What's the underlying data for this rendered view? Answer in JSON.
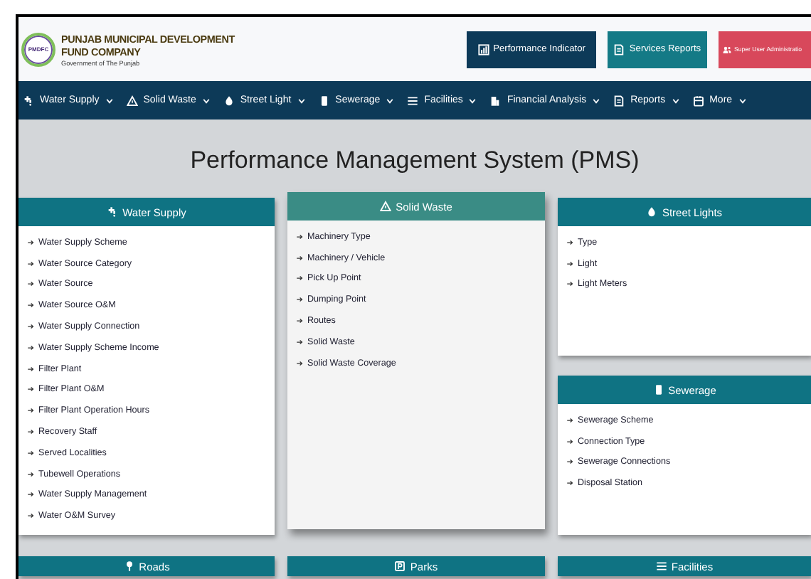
{
  "header": {
    "logo_text": "PMDFC",
    "org_line1": "PUNJAB MUNICIPAL DEVELOPMENT",
    "org_line2": "FUND COMPANY",
    "subtitle": "Government of The Punjab"
  },
  "buttons": [
    {
      "label": "Performance Indicator",
      "kind": "navy"
    },
    {
      "label": "Services Reports",
      "kind": "teal"
    },
    {
      "label": "Super User Administratio",
      "kind": "danger"
    }
  ],
  "nav": [
    {
      "label": "Water Supply"
    },
    {
      "label": "Solid Waste"
    },
    {
      "label": "Street Light"
    },
    {
      "label": "Sewerage"
    },
    {
      "label": "Facilities"
    },
    {
      "label": "Financial Analysis"
    },
    {
      "label": "Reports"
    },
    {
      "label": "More"
    }
  ],
  "page_title": "Performance Management System (PMS)",
  "cards": [
    {
      "title": "Water Supply",
      "kind": "tall",
      "highlighted": false,
      "items": [
        "Water Supply Scheme",
        "Water Source Category",
        "Water Source",
        "Water Source O&M",
        "Water Supply Connection",
        "Water Supply Scheme Income",
        "Filter Plant",
        "Filter Plant O&M",
        "Filter Plant Operation Hours",
        "Recovery Staff",
        "Served Localities",
        "Tubewell Operations",
        "Water Supply Management",
        "Water O&M Survey"
      ]
    },
    {
      "title": "Roads",
      "kind": "short",
      "highlighted": false
    },
    {
      "title": "Solid Waste",
      "kind": "tall",
      "highlighted": true,
      "items": [
        "Machinery Type",
        "Machinery / Vehicle",
        "Pick Up Point",
        "Dumping Point",
        "Routes",
        "Solid Waste",
        "Solid Waste Coverage"
      ]
    },
    {
      "title": "Parks",
      "kind": "short",
      "highlighted": false
    },
    {
      "title": "Street Lights",
      "kind": "short",
      "highlighted": false,
      "items": [
        "Type",
        "Light",
        "Light Meters"
      ]
    },
    {
      "title": "Sewerage",
      "kind": "short",
      "highlighted": false,
      "items": [
        "Sewerage Scheme",
        "Connection Type",
        "Sewerage Connections",
        "Disposal Station"
      ]
    },
    {
      "title": "Facilities",
      "kind": "short",
      "highlighted": false
    }
  ]
}
